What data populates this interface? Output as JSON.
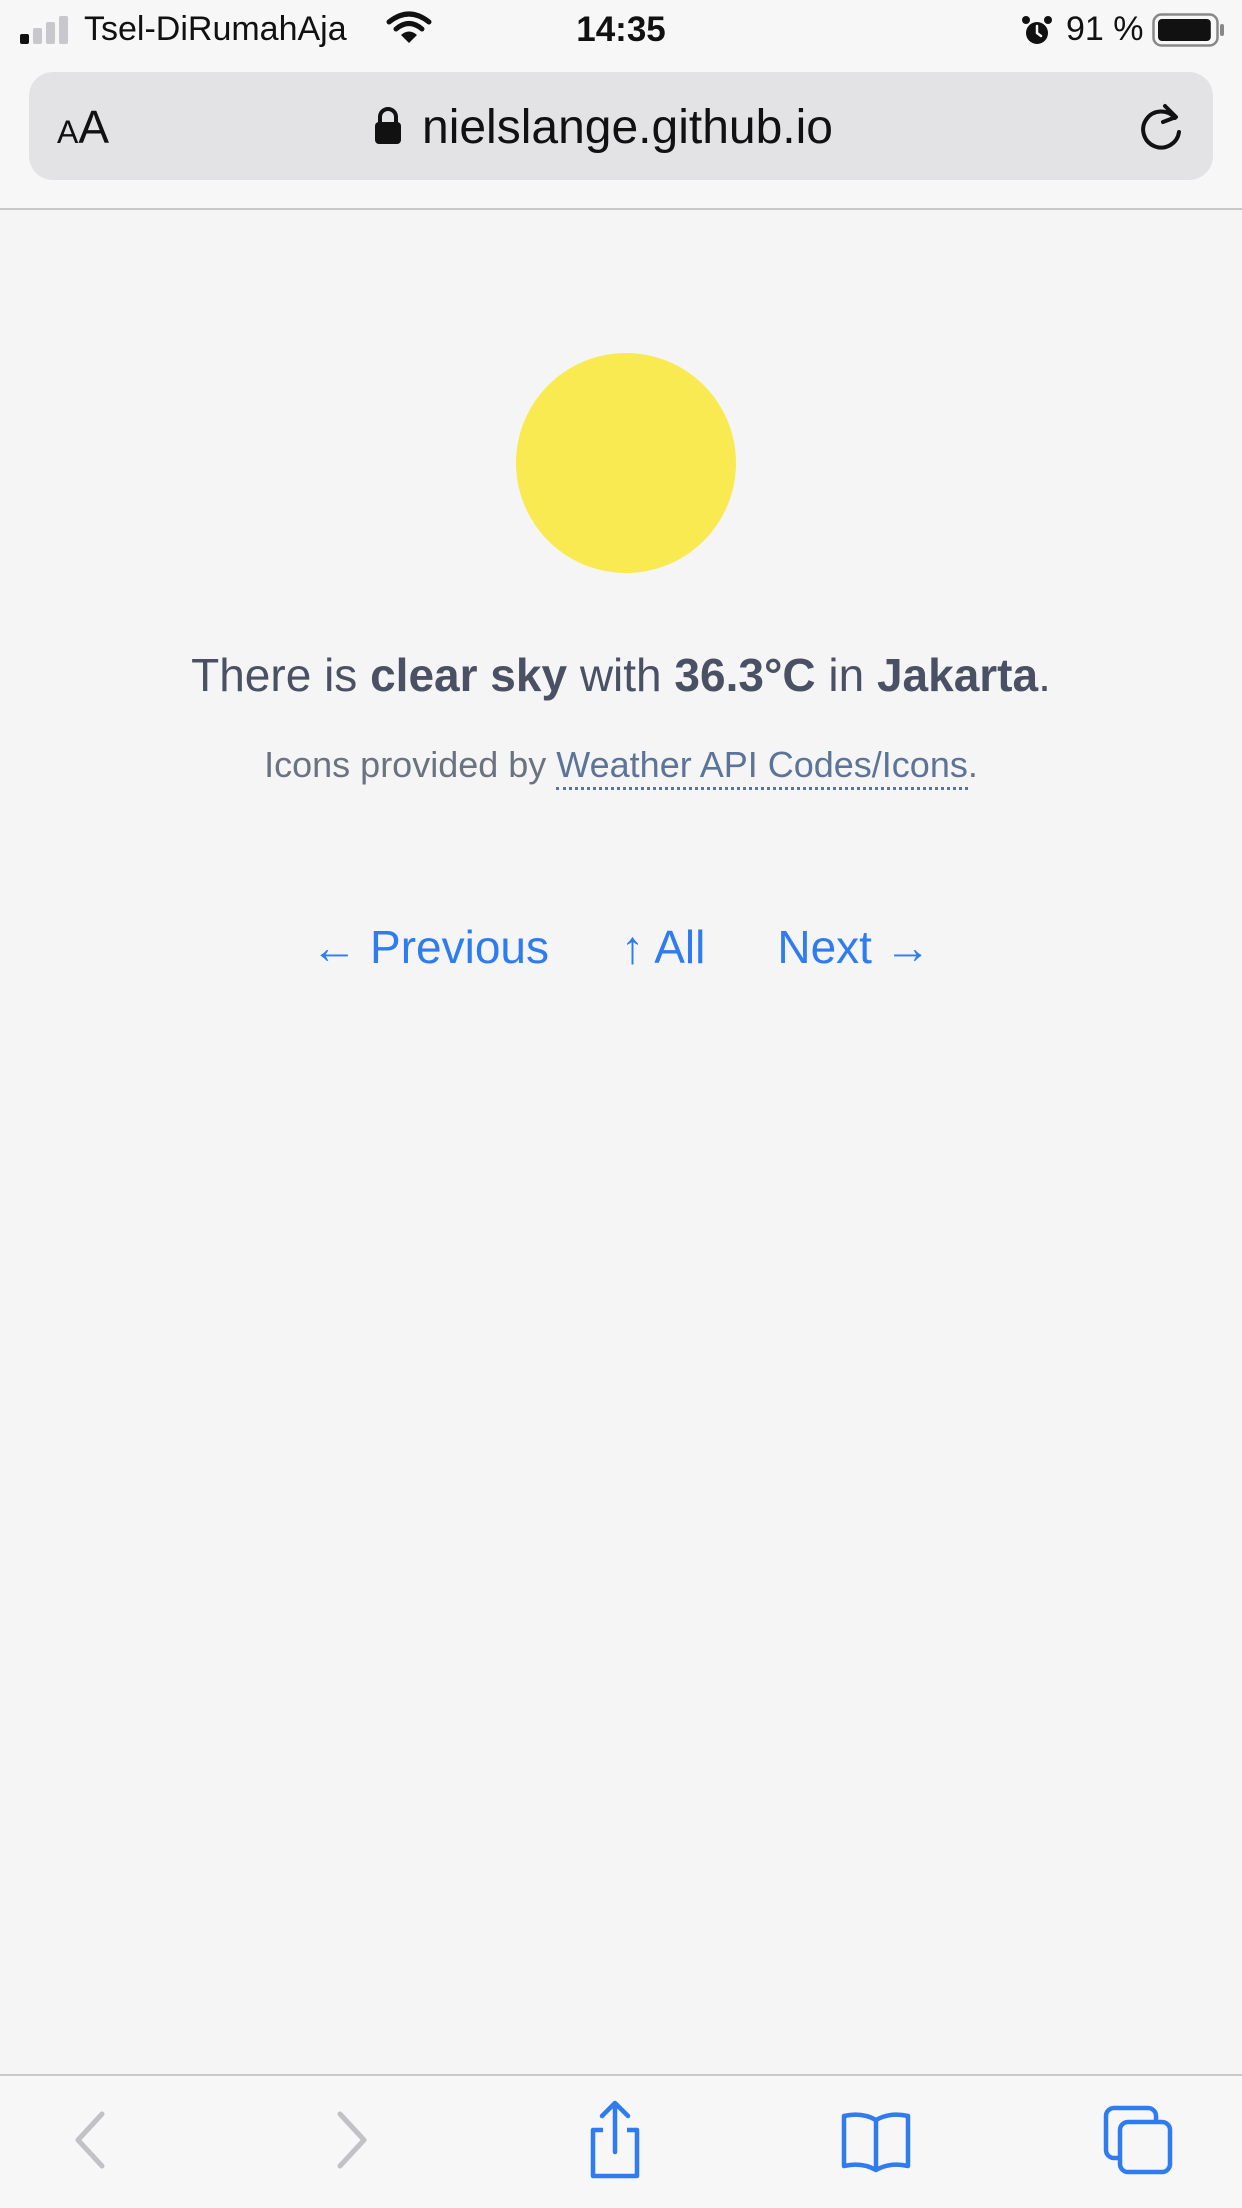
{
  "status_bar": {
    "carrier": "Tsel-DiRumahAja",
    "time": "14:35",
    "battery_percent": "91 %",
    "battery_level": 0.91
  },
  "address_bar": {
    "text_size_small": "A",
    "text_size_large": "A",
    "url": "nielslange.github.io",
    "icons": [
      "lock-icon",
      "reload-icon"
    ]
  },
  "weather": {
    "icon": "sun-icon",
    "prefix": "There is ",
    "condition": "clear sky",
    "mid": " with ",
    "temperature": "36.3°C",
    "in": " in ",
    "city": "Jakarta",
    "end": ".",
    "credit_prefix": "Icons provided by ",
    "credit_link": "Weather API Codes/Icons",
    "credit_end": "."
  },
  "nav": {
    "previous": "← Previous",
    "all": "↑ All",
    "next": "Next →"
  },
  "toolbar": {
    "icons": [
      "back-icon",
      "forward-icon",
      "share-icon",
      "bookmarks-icon",
      "tabs-icon"
    ]
  },
  "colors": {
    "background": "#f5f5f6",
    "sun": "#f9ea52",
    "link": "#2e7cf0",
    "text": "#4b5164"
  }
}
